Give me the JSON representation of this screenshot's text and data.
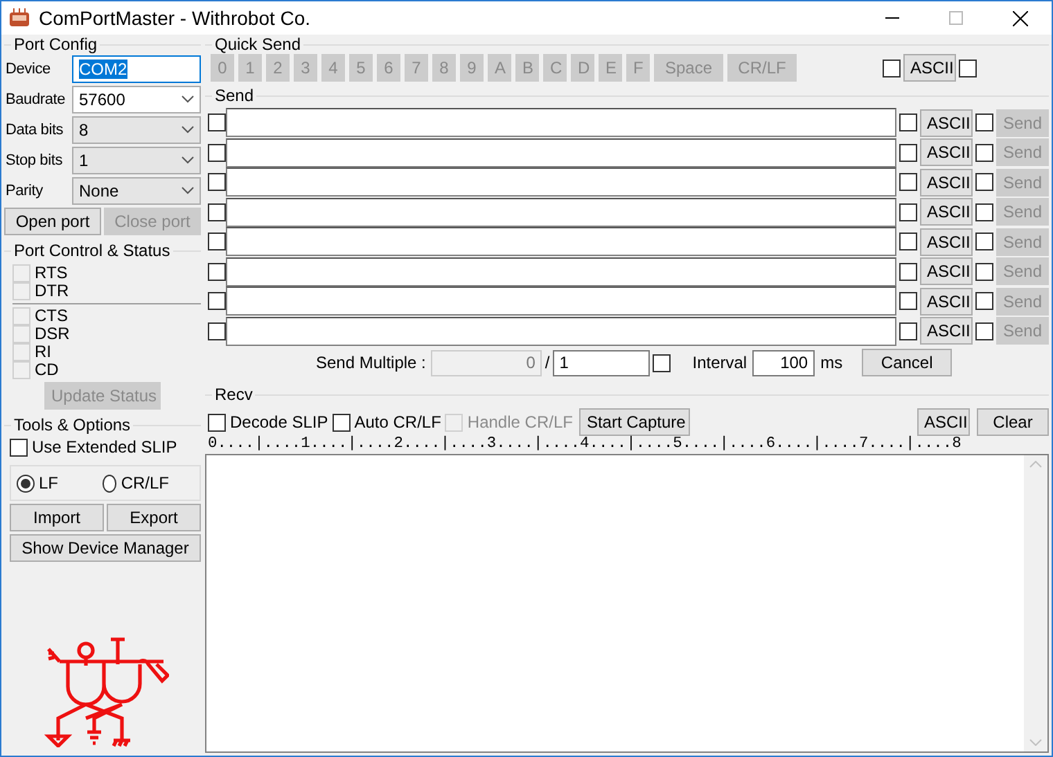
{
  "window": {
    "title": "ComPortMaster - Withrobot Co."
  },
  "port_config": {
    "title": "Port Config",
    "fields": [
      {
        "label": "Device",
        "value": "COM2",
        "kind": "input",
        "selected": true
      },
      {
        "label": "Baudrate",
        "value": "57600",
        "kind": "combo"
      },
      {
        "label": "Data bits",
        "value": "8",
        "kind": "select"
      },
      {
        "label": "Stop bits",
        "value": "1",
        "kind": "select"
      },
      {
        "label": "Parity",
        "value": "None",
        "kind": "select"
      }
    ],
    "buttons": [
      {
        "label": "Open port",
        "disabled": false
      },
      {
        "label": "Close port",
        "disabled": true
      }
    ]
  },
  "port_control": {
    "title": "Port Control & Status",
    "outputs": [
      {
        "label": "RTS",
        "checked": false,
        "disabled": true
      },
      {
        "label": "DTR",
        "checked": false,
        "disabled": true
      }
    ],
    "inputs": [
      {
        "label": "CTS",
        "checked": false,
        "disabled": true
      },
      {
        "label": "DSR",
        "checked": false,
        "disabled": true
      },
      {
        "label": "RI",
        "checked": false,
        "disabled": true
      },
      {
        "label": "CD",
        "checked": false,
        "disabled": true
      }
    ],
    "update_button": {
      "label": "Update Status",
      "disabled": true
    }
  },
  "tools": {
    "title": "Tools & Options",
    "extended_slip": {
      "label": "Use Extended SLIP",
      "checked": false
    },
    "line_endings": [
      {
        "label": "LF",
        "selected": true
      },
      {
        "label": "CR/LF",
        "selected": false
      }
    ],
    "buttons": [
      {
        "label": "Import"
      },
      {
        "label": "Export"
      },
      {
        "label": "Show Device Manager"
      }
    ]
  },
  "quick_send": {
    "title": "Quick Send",
    "keys": [
      {
        "label": "0",
        "disabled": true
      },
      {
        "label": "1",
        "disabled": true
      },
      {
        "label": "2",
        "disabled": true
      },
      {
        "label": "3",
        "disabled": true
      },
      {
        "label": "4",
        "disabled": true
      },
      {
        "label": "5",
        "disabled": true
      },
      {
        "label": "6",
        "disabled": true
      },
      {
        "label": "7",
        "disabled": true
      },
      {
        "label": "8",
        "disabled": true
      },
      {
        "label": "9",
        "disabled": true
      },
      {
        "label": "A",
        "disabled": true
      },
      {
        "label": "B",
        "disabled": true
      },
      {
        "label": "C",
        "disabled": true
      },
      {
        "label": "D",
        "disabled": true
      },
      {
        "label": "E",
        "disabled": true
      },
      {
        "label": "F",
        "disabled": true
      },
      {
        "label": "Space",
        "disabled": true
      },
      {
        "label": "CR/LF",
        "disabled": true
      }
    ],
    "mode_checked": false,
    "mode_button": "ASCII",
    "extra_checked": false
  },
  "send": {
    "title": "Send",
    "rows": [
      {
        "checked": false,
        "mode_checked": false,
        "mode_button": "ASCII",
        "repeat_checked": false,
        "send_button": "Send",
        "send_disabled": true
      },
      {
        "checked": false,
        "mode_checked": false,
        "mode_button": "ASCII",
        "repeat_checked": false,
        "send_button": "Send",
        "send_disabled": true
      },
      {
        "checked": false,
        "mode_checked": false,
        "mode_button": "ASCII",
        "repeat_checked": false,
        "send_button": "Send",
        "send_disabled": true
      },
      {
        "checked": false,
        "mode_checked": false,
        "mode_button": "ASCII",
        "repeat_checked": false,
        "send_button": "Send",
        "send_disabled": true
      },
      {
        "checked": false,
        "mode_checked": false,
        "mode_button": "ASCII",
        "repeat_checked": false,
        "send_button": "Send",
        "send_disabled": true
      },
      {
        "checked": false,
        "mode_checked": false,
        "mode_button": "ASCII",
        "repeat_checked": false,
        "send_button": "Send",
        "send_disabled": true
      },
      {
        "checked": false,
        "mode_checked": false,
        "mode_button": "ASCII",
        "repeat_checked": false,
        "send_button": "Send",
        "send_disabled": true
      },
      {
        "checked": false,
        "mode_checked": false,
        "mode_button": "ASCII",
        "repeat_checked": false,
        "send_button": "Send",
        "send_disabled": true
      }
    ],
    "multiple": {
      "label": "Send Multiple :",
      "count": "0",
      "separator": "/",
      "total": "1",
      "loop_checked": false,
      "interval_label": "Interval",
      "interval": "100",
      "unit": "ms",
      "cancel_button": "Cancel"
    }
  },
  "recv": {
    "title": "Recv",
    "options": [
      {
        "label": "Decode SLIP",
        "checked": false,
        "disabled": false
      },
      {
        "label": "Auto CR/LF",
        "checked": false,
        "disabled": false
      },
      {
        "label": "Handle CR/LF",
        "checked": false,
        "disabled": true
      }
    ],
    "capture_button": "Start Capture",
    "mode_button": "ASCII",
    "clear_button": "Clear",
    "ruler": "0....|....1....|....2....|....3....|....4....|....5....|....6....|....7....|....8"
  }
}
